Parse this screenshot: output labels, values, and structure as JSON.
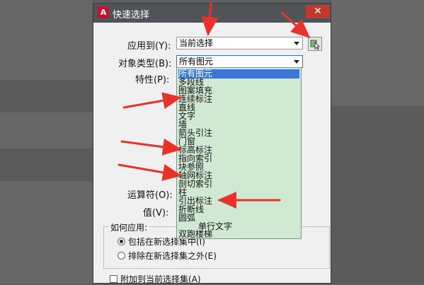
{
  "dialog": {
    "title": "快速选择",
    "app_icon_glyph": "A",
    "close_glyph": "✕",
    "apply_to": {
      "label": "应用到(Y):",
      "value": "当前选择"
    },
    "object_type": {
      "label": "对象类型(B):",
      "value": "所有图元"
    },
    "properties_label": "特性(P):",
    "operator_label": "运算符(O):",
    "value_label": "值(V):",
    "how_to_apply": {
      "title": "如何应用:",
      "include": "包括在新选择集中(I)",
      "exclude": "排除在新选择集之外(E)",
      "selected": "include"
    },
    "append_label": "附加到当前选择集(A)",
    "dropdown_items": [
      "所有图元",
      "多段线",
      "图案填充",
      "连续标注",
      "直线",
      "文字",
      "墙",
      "箭头引注",
      "门窗",
      "标高标注",
      "指向索引",
      "块参照",
      "轴网标注",
      "剖切索引",
      "柱",
      "引出标注",
      "折断线",
      "圆弧",
      "单行文字",
      "双跑楼梯"
    ],
    "selected_item": "所有图元"
  },
  "colors": {
    "arrow": "#e8322a",
    "dropdown_bg": "#cfe9d2",
    "selection": "#3b76d4"
  }
}
